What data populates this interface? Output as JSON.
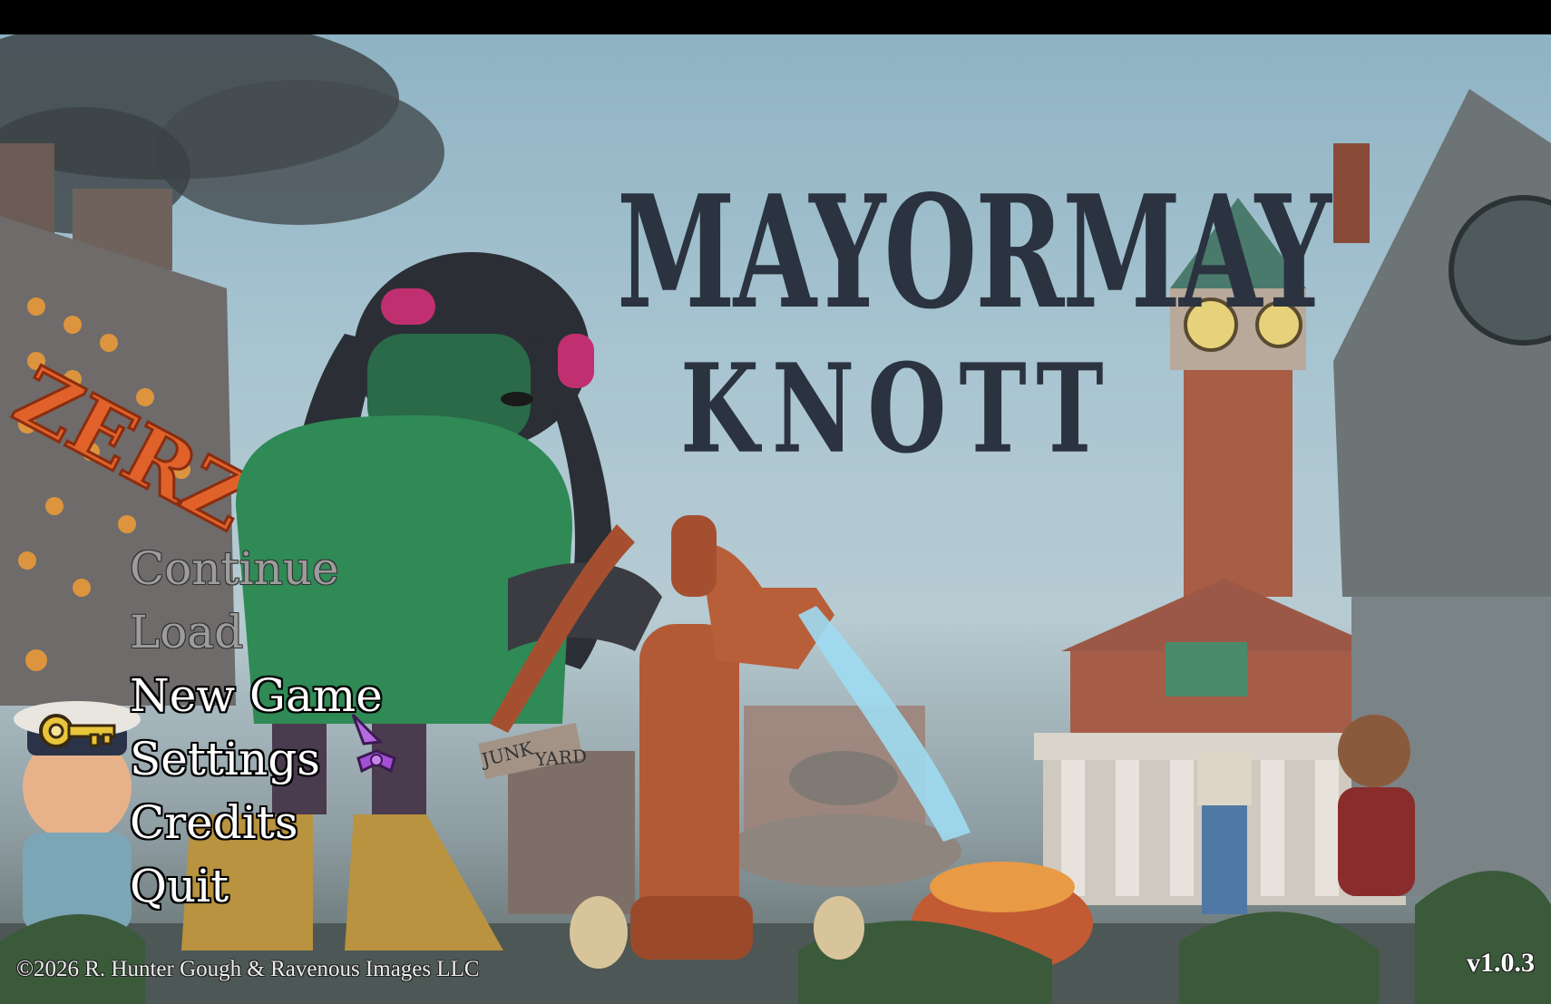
{
  "title": {
    "line1": "MAYORMAY",
    "line2": "KNOTT"
  },
  "menu": {
    "items": [
      {
        "label": "Continue",
        "enabled": false
      },
      {
        "label": "Load",
        "enabled": false
      },
      {
        "label": "New Game",
        "enabled": true,
        "selected": true
      },
      {
        "label": "Settings",
        "enabled": true
      },
      {
        "label": "Credits",
        "enabled": true
      },
      {
        "label": "Quit",
        "enabled": true
      }
    ],
    "selector_icon": "key-icon"
  },
  "sign": {
    "text": "ZERZ"
  },
  "junkyard_sign": {
    "word1": "JUNK",
    "word2": "YARD"
  },
  "footer": {
    "copyright": "©2026 R. Hunter Gough & Ravenous Images LLC",
    "version": "v1.0.3"
  },
  "colors": {
    "menu_text": "#ffffff",
    "menu_disabled": "#9c9c9c",
    "logo": "#2b3340",
    "key": "#e8c53a"
  }
}
